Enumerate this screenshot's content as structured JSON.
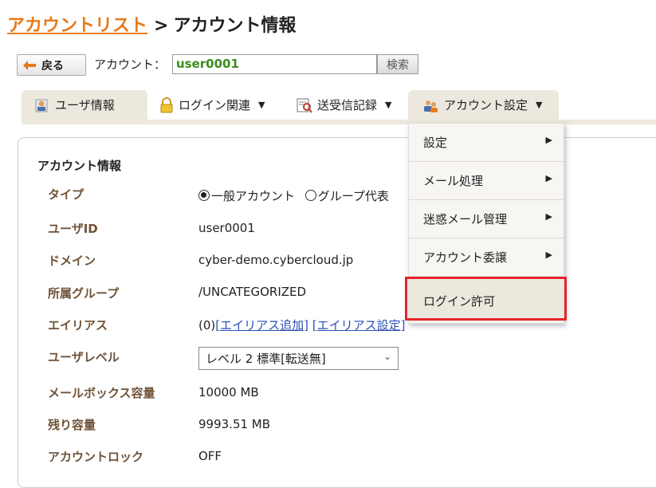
{
  "header": {
    "breadcrumb_link": "アカウントリスト",
    "separator": ">",
    "current": "アカウント情報"
  },
  "toolbar": {
    "back_label": "戻る",
    "account_label": "アカウント：",
    "account_value": "user0001",
    "search_label": "検索"
  },
  "tabs": [
    {
      "label": "ユーザ情報",
      "icon": "user-icon"
    },
    {
      "label": "ログイン関連",
      "icon": "lock-icon"
    },
    {
      "label": "送受信記録",
      "icon": "log-search-icon"
    },
    {
      "label": "アカウント設定",
      "icon": "users-gear-icon"
    }
  ],
  "section_title": "アカウント情報",
  "fields": {
    "type_label": "タイプ",
    "type_option1": "一般アカウント",
    "type_option2": "グループ代表",
    "userid_label": "ユーザID",
    "userid_value": "user0001",
    "domain_label": "ドメイン",
    "domain_value": "cyber-demo.cybercloud.jp",
    "group_label": "所属グループ",
    "group_value": "/UNCATEGORIZED",
    "alias_label": "エイリアス",
    "alias_count": "(0)",
    "alias_add": "[エイリアス追加]",
    "alias_settings": "[エイリアス設定]",
    "level_label": "ユーザレベル",
    "level_value": "レベル 2 標準[転送無]",
    "mailbox_label": "メールボックス容量",
    "mailbox_value": "10000 MB",
    "remaining_label": "残り容量",
    "remaining_value": "9993.51 MB",
    "lock_label": "アカウントロック",
    "lock_value": "OFF"
  },
  "dropdown": {
    "items": [
      "設定",
      "メール処理",
      "迷惑メール管理",
      "アカウント委譲",
      "ログイン許可"
    ]
  },
  "colors": {
    "accent": "#e8791a",
    "tab_bg": "#ece8dd",
    "label_brown": "#6f5338",
    "highlight_red": "#e5252b",
    "account_green": "#3b8c1a"
  }
}
